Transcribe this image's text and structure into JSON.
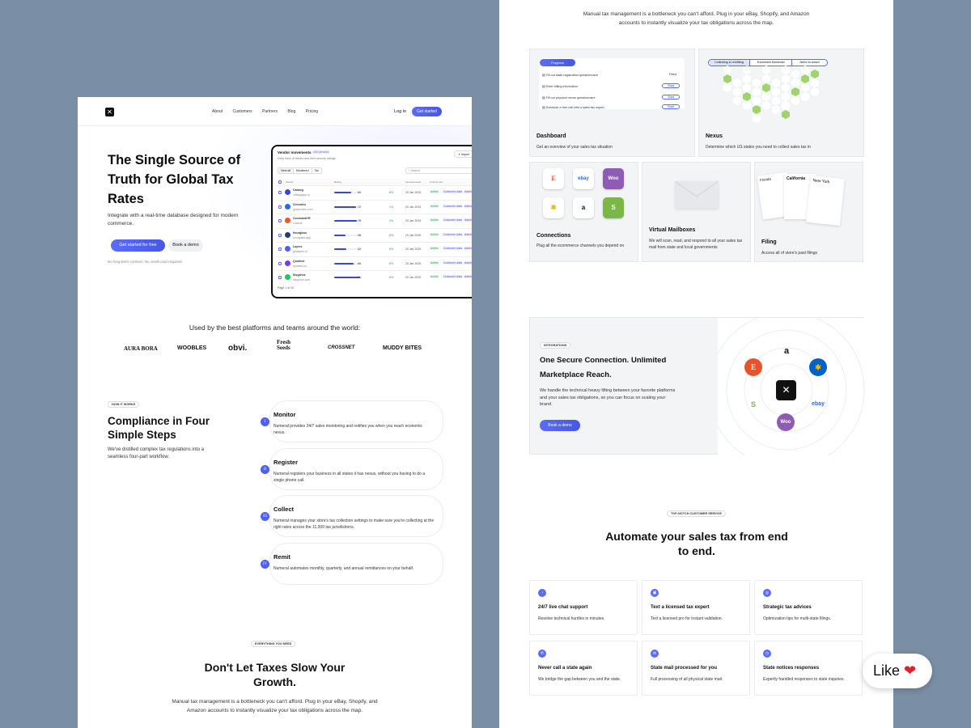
{
  "left": {
    "nav": {
      "logo_glyph": "✕",
      "links": [
        "About",
        "Customers",
        "Partners",
        "Blog",
        "Pricing"
      ],
      "login": "Log in",
      "cta": "Get started"
    },
    "hero": {
      "title": "The Single Source of Truth for Global Tax Rates",
      "subtitle": "Integrate with a real-time database designed for modern commerce.",
      "primary_cta": "Get started for free",
      "secondary_cta": "Book a demo",
      "note": "No long-term contract. No credit card required."
    },
    "mockup": {
      "title": "Vendor movements",
      "badge": "100 vendors",
      "subtitle": "Keep track of vendor and their security ratings.",
      "import": "Import",
      "tabs": [
        "View all",
        "Monitored",
        "Tax"
      ],
      "search_placeholder": "Search",
      "columns": [
        "Vendor",
        "Rating",
        "Last assessed",
        "Licence use"
      ],
      "rows": [
        {
          "name": "Catalog",
          "site": "catalogapp.io",
          "score": "60",
          "change": "8%",
          "date": "20 Jan 2026",
          "color": "#3747d6",
          "progress": 0.62
        },
        {
          "name": "Circooles",
          "site": "getcirooles.com",
          "score": "72",
          "change": "1%",
          "date": "20 Jan 2026",
          "color": "#2b6ae6",
          "progress": 0.78
        },
        {
          "name": "Command+R",
          "site": "cmdr.ai",
          "score": "78",
          "change": "4%",
          "date": "20 Jan 2026",
          "color": "#e65a2b",
          "progress": 0.82
        },
        {
          "name": "Hourglass",
          "site": "hourglass.app",
          "score": "38",
          "change": "8%",
          "date": "20 Jan 2026",
          "color": "#1e3a8a",
          "progress": 0.4
        },
        {
          "name": "Layers",
          "site": "getlayers.io",
          "score": "42",
          "change": "6%",
          "date": "20 Jan 2026",
          "color": "#4f5ff0",
          "progress": 0.45
        },
        {
          "name": "Quotient",
          "site": "quotient.co",
          "score": "66",
          "change": "8%",
          "date": "20 Jan 2026",
          "color": "#7c3aed",
          "progress": 0.7
        },
        {
          "name": "Sisyphus",
          "site": "sisyphus.com",
          "score": "91",
          "change": "8%",
          "date": "20 Jan 2026",
          "color": "#22c55e",
          "progress": 0.95
        }
      ],
      "tags": [
        "Active",
        "Customer data",
        "Admin"
      ],
      "pagination": "Page 1 of 10"
    },
    "logos": {
      "heading": "Used by the best platforms and teams around the world:",
      "items": [
        "AURA BORA",
        "WOOBLES",
        "obvi.",
        "Fresh Seeds",
        "CROSSNET",
        "MUDDY BITES"
      ]
    },
    "steps": {
      "pill": "HOW IT WORKS",
      "title": "Compliance in Four Simple Steps",
      "subtitle": "We've distilled complex tax regulations into a seamless four-part workflow.",
      "items": [
        {
          "num": "I",
          "title": "Monitor",
          "desc": "Numeral provides 24/7 sales monitoring and notifies you when you reach economic nexus."
        },
        {
          "num": "II",
          "title": "Register",
          "desc": "Numeral registers your business in all states it has nexus, without you having to do a single phone call."
        },
        {
          "num": "III",
          "title": "Collect",
          "desc": "Numeral manages your store's tax collection settings to make sure you're collecting at the right rates across the 11,000 tax jurisdictions."
        },
        {
          "num": "IV",
          "title": "Remit",
          "desc": "Numeral automates monthly, quarterly, and annual remittances on your behalf."
        }
      ]
    },
    "everything": {
      "pill": "EVERYTHING YOU NEED",
      "title": "Don't Let Taxes Slow Your Growth.",
      "desc": "Manual tax management is a bottleneck you can't afford. Plug in your eBay, Shopify, and Amazon accounts to instantly visualize your tax obligations across the map."
    }
  },
  "right": {
    "intro": "Manual tax management is a bottleneck you can't afford. Plug in your eBay, Shopify, and Amazon accounts to instantly visualize your tax obligations across the map.",
    "dashboard": {
      "progress_tab": "Progress",
      "tasks": [
        {
          "label": "Fill out state registration questionnaire",
          "status": "Filled"
        },
        {
          "label": "Enter billing information",
          "status": "Start"
        },
        {
          "label": "Fill out physical nexus questionnaire",
          "status": "Start"
        },
        {
          "label": "Schedule a free call with a sales tax expert",
          "status": "Start"
        }
      ],
      "title": "Dashboard",
      "desc": "Get an overview of your sales tax situation"
    },
    "nexus": {
      "tabs": [
        "Collecting & remitting",
        "Exceeded threshold",
        "Need to watch"
      ],
      "title": "Nexus",
      "desc": "Determine which US states you need to collect sales tax in"
    },
    "connections": {
      "tiles": [
        "E",
        "ebay",
        "Woo",
        "✱",
        "a",
        "S"
      ],
      "title": "Connections",
      "desc": "Plug all the ecommerce channels you depend on"
    },
    "mailboxes": {
      "title": "Virtual Mailboxes",
      "desc": "We will scan, read, and respond to all your sales tax mail from state and local governments"
    },
    "filing": {
      "docs": [
        "Florida",
        "California",
        "New York"
      ],
      "title": "Filing",
      "desc": "Access all of store's past filings"
    },
    "integrations": {
      "pill": "INTEGRATIONS",
      "title": "One Secure Connection. Unlimited Marketplace Reach.",
      "desc": "We handle the technical heavy lifting between your favorite platforms and your sales tax obligations, so you can focus on scaling your brand.",
      "cta": "Book a demo",
      "hub_glyph": "✕",
      "platforms": [
        "a",
        "✱",
        "ebay",
        "Woo",
        "S",
        "E"
      ]
    },
    "service": {
      "pill": "TOP-NOTCH CUSTOMER SERVICE",
      "title": "Automate your sales tax from end to end.",
      "features": [
        {
          "title": "24/7 live chat support",
          "desc": "Resolve technical hurdles in minutes."
        },
        {
          "title": "Text a licensed tax expert",
          "desc": "Text a licensed pro for instant validation."
        },
        {
          "title": "Strategic tax advices",
          "desc": "Optimization tips for multi-state filings."
        },
        {
          "title": "Never call a state again",
          "desc": "We bridge the gap between you and the state."
        },
        {
          "title": "State mail processed for you",
          "desc": "Full processing of all physical state mail."
        },
        {
          "title": "State notices responses",
          "desc": "Expertly handled responses to state inquiries."
        }
      ]
    }
  },
  "like": {
    "label": "Like",
    "icon": "heart-icon"
  },
  "colors": {
    "accent": "#4f5ff0",
    "background": "#7a8ea5",
    "nexus_green": "#9fd36b"
  }
}
